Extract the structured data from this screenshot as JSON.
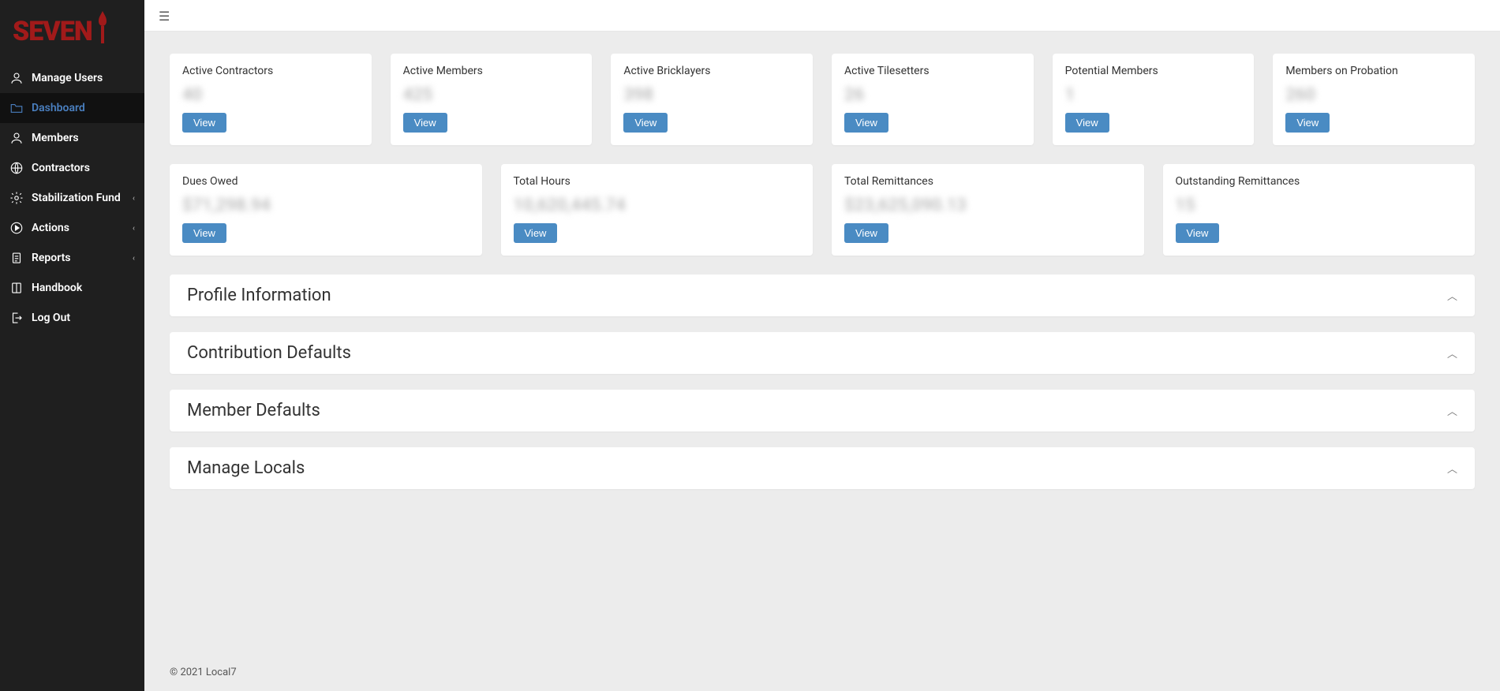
{
  "brand": {
    "name": "SEVEN"
  },
  "sidebar": {
    "items": [
      {
        "label": "Manage Users",
        "icon": "user-icon",
        "chevron": false
      },
      {
        "label": "Dashboard",
        "icon": "folder-icon",
        "chevron": false,
        "active": true
      },
      {
        "label": "Members",
        "icon": "user-icon",
        "chevron": false
      },
      {
        "label": "Contractors",
        "icon": "globe-icon",
        "chevron": false
      },
      {
        "label": "Stabilization Fund",
        "icon": "gear-icon",
        "chevron": true
      },
      {
        "label": "Actions",
        "icon": "play-icon",
        "chevron": true
      },
      {
        "label": "Reports",
        "icon": "clipboard-icon",
        "chevron": true
      },
      {
        "label": "Handbook",
        "icon": "book-icon",
        "chevron": false
      },
      {
        "label": "Log Out",
        "icon": "logout-icon",
        "chevron": false
      }
    ]
  },
  "stats_row1": [
    {
      "title": "Active Contractors",
      "value": "40",
      "button": "View"
    },
    {
      "title": "Active Members",
      "value": "425",
      "button": "View"
    },
    {
      "title": "Active Bricklayers",
      "value": "398",
      "button": "View"
    },
    {
      "title": "Active Tilesetters",
      "value": "26",
      "button": "View"
    },
    {
      "title": "Potential Members",
      "value": "1",
      "button": "View"
    },
    {
      "title": "Members on Probation",
      "value": "260",
      "button": "View"
    }
  ],
  "stats_row2": [
    {
      "title": "Dues Owed",
      "value": "$71,298.94",
      "button": "View"
    },
    {
      "title": "Total Hours",
      "value": "10,620,445.74",
      "button": "View"
    },
    {
      "title": "Total Remittances",
      "value": "$23,625,090.13",
      "button": "View"
    },
    {
      "title": "Outstanding Remittances",
      "value": "15",
      "button": "View"
    }
  ],
  "panels": [
    {
      "title": "Profile Information"
    },
    {
      "title": "Contribution Defaults"
    },
    {
      "title": "Member Defaults"
    },
    {
      "title": "Manage Locals"
    }
  ],
  "footer": {
    "text": "© 2021 Local7"
  }
}
